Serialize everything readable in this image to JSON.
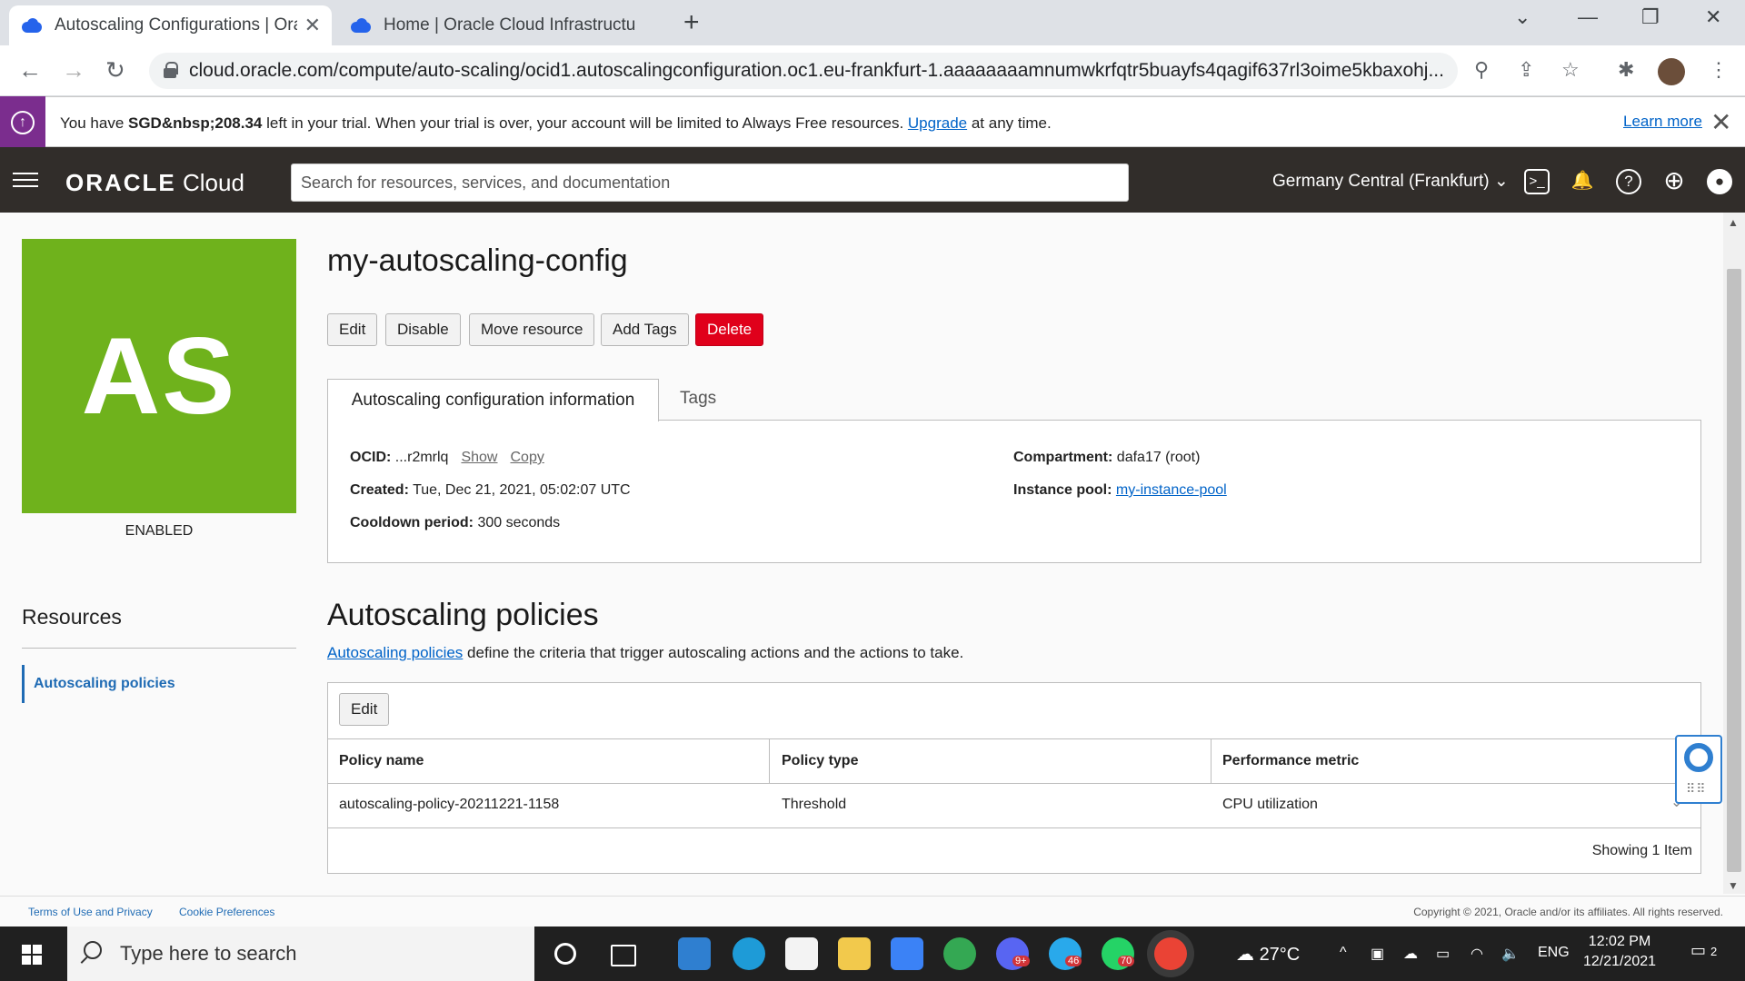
{
  "browser": {
    "tabs": [
      {
        "title": "Autoscaling Configurations | Ora",
        "active": true
      },
      {
        "title": "Home | Oracle Cloud Infrastructu",
        "active": false
      }
    ],
    "new_tab": "+",
    "window_controls": {
      "tab_search": "⌄",
      "minimize": "—",
      "restore": "❐",
      "close": "✕"
    },
    "url": "cloud.oracle.com/compute/auto-scaling/ocid1.autoscalingconfiguration.oc1.eu-frankfurt-1.aaaaaaaamnumwkrfqtr5buayfs4qagif637rl3oime5kbaxohj...",
    "nav": {
      "back": "←",
      "forward": "→",
      "reload": "↻"
    },
    "omni_icons": {
      "zoom": "⚲",
      "share": "⇪",
      "bookmark": "☆",
      "extensions": "✱",
      "menu": "⋮"
    }
  },
  "trial_banner": {
    "text_before": "You have ",
    "amount": "SGD&nbsp;208.34",
    "text_mid": " left in your trial. When your trial is over, your account will be limited to Always Free resources. ",
    "upgrade_link": "Upgrade",
    "text_after": " at any time.",
    "learn_more": "Learn more",
    "close": "✕",
    "icon": "↑"
  },
  "header": {
    "logo_brand": "ORACLE",
    "logo_product": " Cloud",
    "search_placeholder": "Search for resources, services, and documentation",
    "region": "Germany Central (Frankfurt)",
    "region_chevron": "⌄",
    "icons": {
      "cloud_shell": ">_",
      "notifications": "🔔",
      "help": "?",
      "language": "⊕",
      "profile": "●"
    }
  },
  "resource": {
    "avatar_initials": "AS",
    "avatar_color": "#6fb21c",
    "state": "ENABLED",
    "title": "my-autoscaling-config",
    "actions": [
      "Edit",
      "Disable",
      "Move resource",
      "Add Tags",
      "Delete"
    ],
    "tabs": [
      "Autoscaling configuration information",
      "Tags"
    ],
    "info": {
      "ocid_label": "OCID:",
      "ocid_value": "...r2mrlq",
      "show": "Show",
      "copy": "Copy",
      "created_label": "Created:",
      "created_value": "Tue, Dec 21, 2021, 05:02:07 UTC",
      "cooldown_label": "Cooldown period:",
      "cooldown_value": "300 seconds",
      "compartment_label": "Compartment:",
      "compartment_value": "dafa17 (root)",
      "pool_label": "Instance pool:",
      "pool_value": "my-instance-pool"
    }
  },
  "resources_nav": {
    "title": "Resources",
    "items": [
      "Autoscaling policies"
    ]
  },
  "policies": {
    "title": "Autoscaling policies",
    "desc_link": "Autoscaling policies",
    "desc_text": " define the criteria that trigger autoscaling actions and the actions to take.",
    "edit_label": "Edit",
    "columns": [
      "Policy name",
      "Policy type",
      "Performance metric"
    ],
    "rows": [
      {
        "name": "autoscaling-policy-20211221-1158",
        "type": "Threshold",
        "metric": "CPU utilization"
      }
    ],
    "row_chevron": "⌄",
    "count_text": "Showing 1 Item"
  },
  "footer": {
    "terms": "Terms of Use and Privacy",
    "cookies": "Cookie Preferences",
    "copyright": "Copyright © 2021, Oracle and/or its affiliates. All rights reserved."
  },
  "taskbar": {
    "search_placeholder": "Type here to search",
    "badges": {
      "discord": "9+",
      "telegram": "46",
      "whatsapp": "70"
    },
    "weather": "27°C",
    "lang": "ENG",
    "time": "12:02 PM",
    "date": "12/21/2021",
    "notifications": "2",
    "tray_icons": {
      "chevron": "^",
      "meet": "▣",
      "onedrive": "☁",
      "battery": "▭",
      "wifi": "◠",
      "volume": "🔈"
    }
  },
  "colors": {
    "header_bg": "#312d2a",
    "trial_stripe": "#7b2d8e",
    "danger": "#e0001b",
    "link": "#0063c8"
  }
}
